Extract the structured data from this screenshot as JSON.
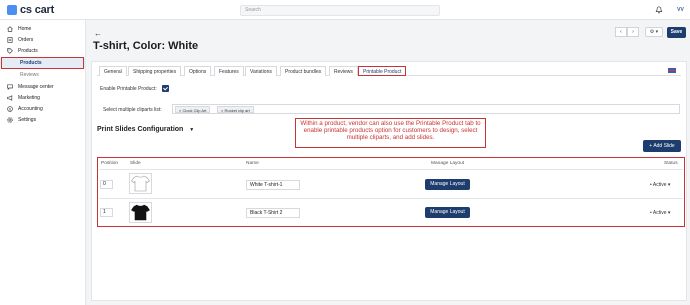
{
  "app": {
    "logo": "cs cart",
    "search_placeholder": "Search",
    "avatar": "VV"
  },
  "sidebar": {
    "items": [
      {
        "label": "Home",
        "icon": "home-icon"
      },
      {
        "label": "Orders",
        "icon": "orders-icon"
      },
      {
        "label": "Products",
        "icon": "tag-icon"
      },
      {
        "label": "Products",
        "icon": ""
      },
      {
        "label": "Reviews",
        "icon": ""
      },
      {
        "label": "Message center",
        "icon": "chat-icon"
      },
      {
        "label": "Marketing",
        "icon": "megaphone-icon"
      },
      {
        "label": "Accounting",
        "icon": "dollar-icon"
      },
      {
        "label": "Settings",
        "icon": "gear-icon"
      }
    ]
  },
  "page": {
    "title": "T-shirt, Color: White",
    "save_label": "Save"
  },
  "tabs": [
    "General",
    "Shipping properties",
    "Options",
    "Features",
    "Variations",
    "Product bundles",
    "Reviews",
    "Printable Product"
  ],
  "form": {
    "enable_label": "Enable Printable Product:",
    "cliparts_label": "Select multiple cliparts list:",
    "cliparts": [
      "Clock Clip Art",
      "Rocket clip art"
    ]
  },
  "slides": {
    "section_title": "Print Slides Configuration",
    "add_label": "Add Slide",
    "headers": {
      "position": "Position",
      "slide": "Slide",
      "name": "Name",
      "manage": "Manage Layout",
      "status": "Status"
    },
    "rows": [
      {
        "position": "0",
        "name": "White T-shirt-1",
        "manage": "Manage Layout",
        "status": "• Active",
        "color": "#ffffff"
      },
      {
        "position": "1",
        "name": "Black T-Shirt 2",
        "manage": "Manage Layout",
        "status": "• Active",
        "color": "#111111"
      }
    ]
  },
  "callout": "Within a product, vendor can also use the Printable Product tab to enable printable products option for customers to design, select multiple cliparts, and add slides.",
  "colors": {
    "accent": "#1d3d6e",
    "highlight": "#c73434"
  }
}
